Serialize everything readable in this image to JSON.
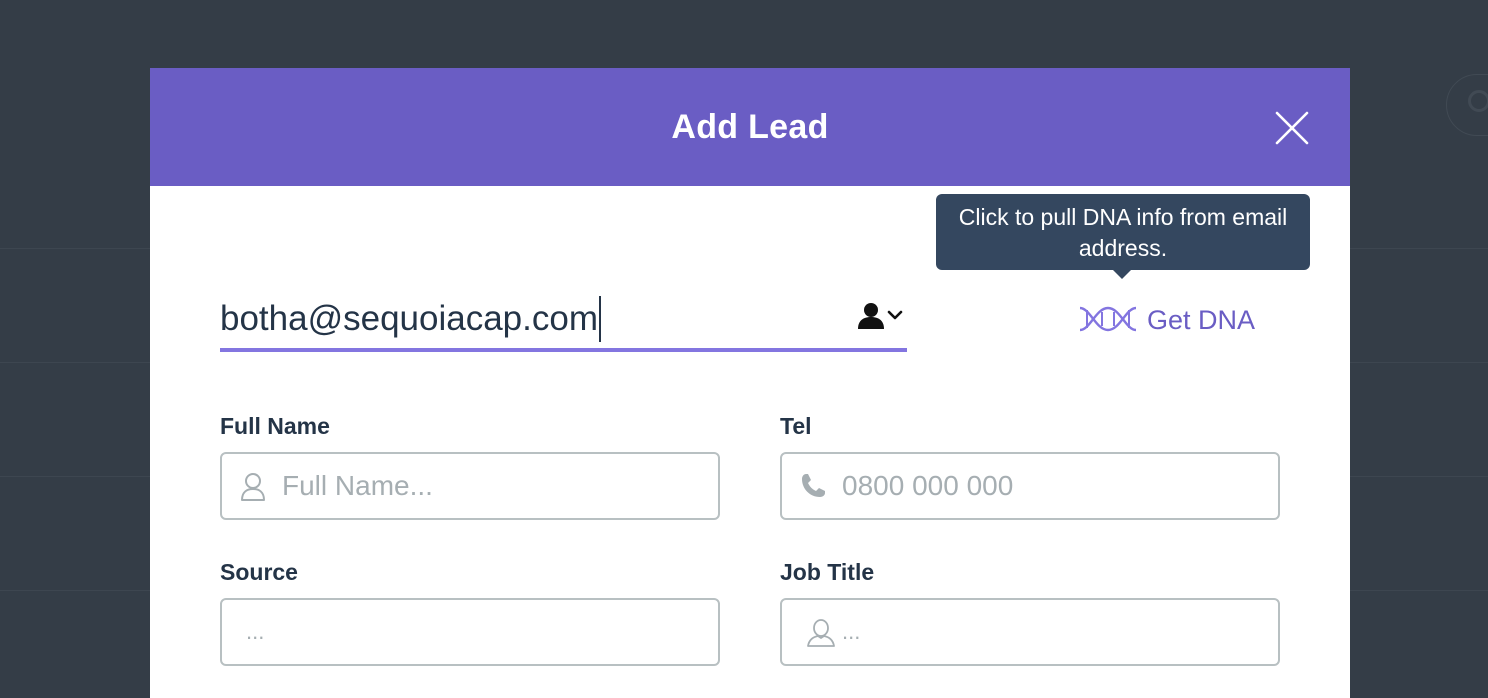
{
  "modal": {
    "title": "Add Lead"
  },
  "tooltip": {
    "text": "Click to pull DNA info from email address."
  },
  "email": {
    "value": "botha@sequoiacap.com"
  },
  "dna_button": {
    "label": "Get DNA",
    "icon": "dna-icon"
  },
  "fields": {
    "full_name": {
      "label": "Full Name",
      "placeholder": "Full Name...",
      "icon": "user-outline-icon"
    },
    "tel": {
      "label": "Tel",
      "placeholder": "0800 000 000",
      "icon": "phone-icon"
    },
    "source": {
      "label": "Source",
      "placeholder": "..."
    },
    "job_title": {
      "label": "Job Title",
      "placeholder": "...",
      "icon": "user-outline-icon"
    }
  },
  "colors": {
    "header": "#6a5dc4",
    "accent": "#8375e0",
    "tooltip": "#34475f",
    "text": "#243447",
    "placeholder": "#a6aeb2",
    "backdrop": "#343d47"
  }
}
